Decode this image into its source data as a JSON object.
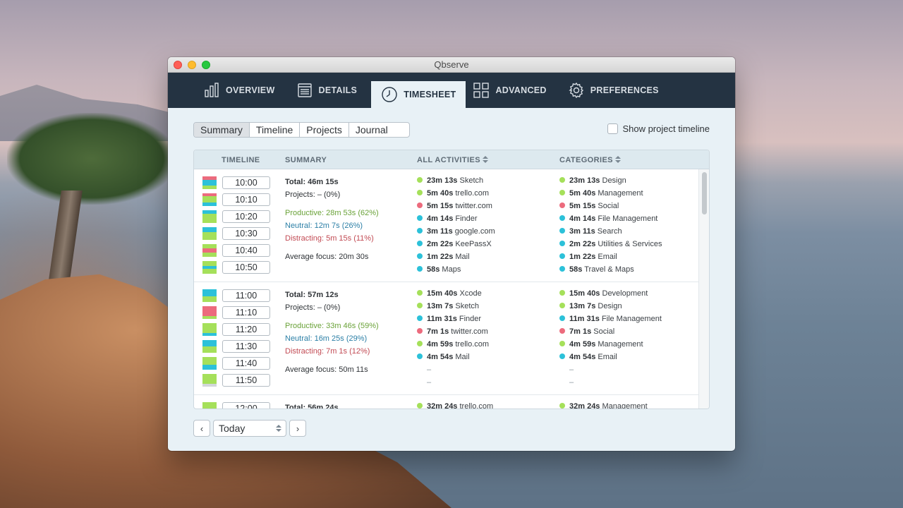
{
  "window": {
    "title": "Qbserve"
  },
  "tabs": [
    {
      "label": "OVERVIEW",
      "icon": "bar-chart-icon"
    },
    {
      "label": "DETAILS",
      "icon": "list-icon"
    },
    {
      "label": "TIMESHEET",
      "icon": "clock-icon",
      "active": true
    },
    {
      "label": "ADVANCED",
      "icon": "grid-icon"
    },
    {
      "label": "PREFERENCES",
      "icon": "gear-icon"
    }
  ],
  "views": [
    "Summary",
    "Timeline",
    "Projects",
    "Journal"
  ],
  "selected_view": "Summary",
  "show_project_timeline": {
    "label": "Show project timeline",
    "checked": false
  },
  "columns": {
    "timeline": "TIMELINE",
    "summary": "SUMMARY",
    "activities": "ALL ACTIVITIES",
    "categories": "CATEGORIES"
  },
  "colors": {
    "productive": "#a5e05a",
    "neutral": "#2cc1d9",
    "distracting": "#ec6b7d",
    "idle": "#d2d6da"
  },
  "hours": [
    {
      "slots": [
        {
          "time": "10:00",
          "segments": [
            [
              "distracting",
              0.3
            ],
            [
              "neutral",
              0.45
            ],
            [
              "productive",
              0.25
            ]
          ]
        },
        {
          "time": "10:10",
          "segments": [
            [
              "distracting",
              0.2
            ],
            [
              "productive",
              0.55
            ],
            [
              "neutral",
              0.25
            ]
          ]
        },
        {
          "time": "10:20",
          "segments": [
            [
              "neutral",
              0.3
            ],
            [
              "productive",
              0.7
            ]
          ]
        },
        {
          "time": "10:30",
          "segments": [
            [
              "neutral",
              0.4
            ],
            [
              "productive",
              0.6
            ]
          ]
        },
        {
          "time": "10:40",
          "segments": [
            [
              "productive",
              0.35
            ],
            [
              "distracting",
              0.3
            ],
            [
              "productive",
              0.35
            ]
          ]
        },
        {
          "time": "10:50",
          "segments": [
            [
              "productive",
              0.4
            ],
            [
              "neutral",
              0.2
            ],
            [
              "productive",
              0.4
            ]
          ]
        }
      ],
      "total": "Total: 46m 15s",
      "projects": "Projects: – (0%)",
      "productive": "Productive: 28m 53s (62%)",
      "neutral": "Neutral: 12m 7s (26%)",
      "distracting": "Distracting: 5m 15s (11%)",
      "focus": "Average focus: 20m 30s",
      "activities": [
        {
          "time": "23m 13s",
          "name": "Sketch",
          "kind": "productive"
        },
        {
          "time": "5m 40s",
          "name": "trello.com",
          "kind": "productive"
        },
        {
          "time": "5m 15s",
          "name": "twitter.com",
          "kind": "distracting"
        },
        {
          "time": "4m 14s",
          "name": "Finder",
          "kind": "neutral"
        },
        {
          "time": "3m 11s",
          "name": "google.com",
          "kind": "neutral"
        },
        {
          "time": "2m 22s",
          "name": "KeePassX",
          "kind": "neutral"
        },
        {
          "time": "1m 22s",
          "name": "Mail",
          "kind": "neutral"
        },
        {
          "time": "58s",
          "name": "Maps",
          "kind": "neutral"
        }
      ],
      "categories": [
        {
          "time": "23m 13s",
          "name": "Design",
          "kind": "productive"
        },
        {
          "time": "5m 40s",
          "name": "Management",
          "kind": "productive"
        },
        {
          "time": "5m 15s",
          "name": "Social",
          "kind": "distracting"
        },
        {
          "time": "4m 14s",
          "name": "File Management",
          "kind": "neutral"
        },
        {
          "time": "3m 11s",
          "name": "Search",
          "kind": "neutral"
        },
        {
          "time": "2m 22s",
          "name": "Utilities & Services",
          "kind": "neutral"
        },
        {
          "time": "1m 22s",
          "name": "Email",
          "kind": "neutral"
        },
        {
          "time": "58s",
          "name": "Travel & Maps",
          "kind": "neutral"
        }
      ]
    },
    {
      "slots": [
        {
          "time": "11:00",
          "segments": [
            [
              "neutral",
              0.55
            ],
            [
              "productive",
              0.45
            ]
          ]
        },
        {
          "time": "11:10",
          "segments": [
            [
              "distracting",
              0.8
            ],
            [
              "productive",
              0.2
            ]
          ]
        },
        {
          "time": "11:20",
          "segments": [
            [
              "productive",
              0.75
            ],
            [
              "neutral",
              0.25
            ]
          ]
        },
        {
          "time": "11:30",
          "segments": [
            [
              "neutral",
              0.5
            ],
            [
              "productive",
              0.5
            ]
          ]
        },
        {
          "time": "11:40",
          "segments": [
            [
              "productive",
              0.6
            ],
            [
              "neutral",
              0.4
            ]
          ]
        },
        {
          "time": "11:50",
          "segments": [
            [
              "productive",
              0.8
            ],
            [
              "idle",
              0.2
            ]
          ]
        }
      ],
      "total": "Total: 57m 12s",
      "projects": "Projects: – (0%)",
      "productive": "Productive: 33m 46s (59%)",
      "neutral": "Neutral: 16m 25s (29%)",
      "distracting": "Distracting: 7m 1s (12%)",
      "focus": "Average focus: 50m 11s",
      "activities": [
        {
          "time": "15m 40s",
          "name": "Xcode",
          "kind": "productive"
        },
        {
          "time": "13m 7s",
          "name": "Sketch",
          "kind": "productive"
        },
        {
          "time": "11m 31s",
          "name": "Finder",
          "kind": "neutral"
        },
        {
          "time": "7m 1s",
          "name": "twitter.com",
          "kind": "distracting"
        },
        {
          "time": "4m 59s",
          "name": "trello.com",
          "kind": "productive"
        },
        {
          "time": "4m 54s",
          "name": "Mail",
          "kind": "neutral"
        }
      ],
      "categories": [
        {
          "time": "15m 40s",
          "name": "Development",
          "kind": "productive"
        },
        {
          "time": "13m 7s",
          "name": "Design",
          "kind": "productive"
        },
        {
          "time": "11m 31s",
          "name": "File Management",
          "kind": "neutral"
        },
        {
          "time": "7m 1s",
          "name": "Social",
          "kind": "distracting"
        },
        {
          "time": "4m 59s",
          "name": "Management",
          "kind": "productive"
        },
        {
          "time": "4m 54s",
          "name": "Email",
          "kind": "neutral"
        }
      ],
      "empty_rows": 2
    },
    {
      "slots": [
        {
          "time": "12:00",
          "segments": [
            [
              "productive",
              1
            ]
          ]
        }
      ],
      "total": "Total: 56m 24s",
      "activities": [
        {
          "time": "32m 24s",
          "name": "trello.com",
          "kind": "productive"
        }
      ],
      "categories": [
        {
          "time": "32m 24s",
          "name": "Management",
          "kind": "productive"
        }
      ]
    }
  ],
  "footer": {
    "prev": "‹",
    "next": "›",
    "date": "Today"
  }
}
